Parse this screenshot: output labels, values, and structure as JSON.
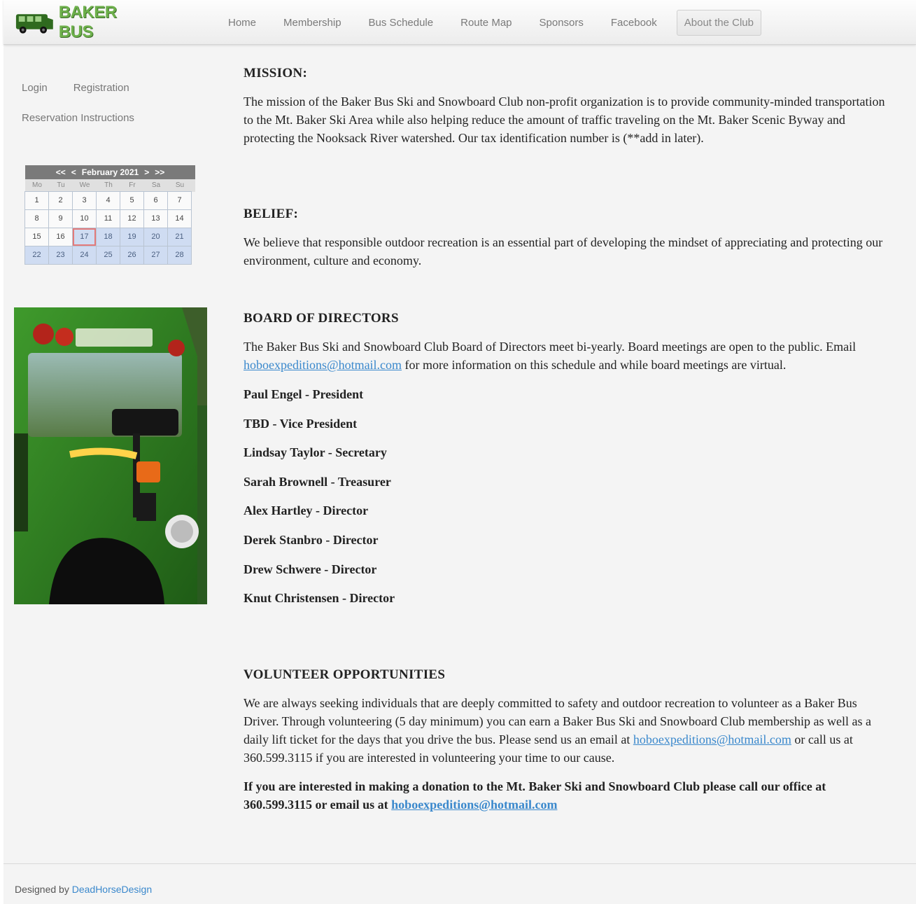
{
  "header": {
    "logo_text": "BAKER BUS",
    "nav": [
      "Home",
      "Membership",
      "Bus Schedule",
      "Route Map",
      "Sponsors",
      "Facebook",
      "About the Club"
    ],
    "active_nav": "About the Club"
  },
  "sidebar": {
    "login": "Login",
    "registration": "Registration",
    "reservation": "Reservation Instructions"
  },
  "calendar": {
    "prev_year": "<<",
    "prev_month": "<",
    "month_label": "February 2021",
    "next_month": ">",
    "next_year": ">>",
    "weekdays": [
      "Mo",
      "Tu",
      "We",
      "Th",
      "Fr",
      "Sa",
      "Su"
    ],
    "weeks": [
      [
        1,
        2,
        3,
        4,
        5,
        6,
        7
      ],
      [
        8,
        9,
        10,
        11,
        12,
        13,
        14
      ],
      [
        15,
        16,
        17,
        18,
        19,
        20,
        21
      ],
      [
        22,
        23,
        24,
        25,
        26,
        27,
        28
      ]
    ],
    "today": 17
  },
  "mission": {
    "heading": "MISSION:",
    "text": "The mission of the Baker Bus Ski and Snowboard Club non-profit organization is to provide community-minded transportation to the Mt. Baker Ski Area while also helping reduce the amount of traffic traveling on the Mt. Baker Scenic Byway and protecting the Nooksack River watershed. Our tax identification number is (**add in later)."
  },
  "belief": {
    "heading": "BELIEF:",
    "text": "We believe that responsible outdoor recreation is an essential part of developing the mindset of appreciating and protecting our environment, culture and economy."
  },
  "board": {
    "heading": "BOARD OF DIRECTORS",
    "text_before": "The Baker Bus Ski and Snowboard Club Board of Directors meet bi-yearly. Board meetings are open to the public. Email ",
    "email": "hoboexpeditions@hotmail.com",
    "text_after": " for more information on this schedule and while board meetings are virtual.",
    "members": [
      "Paul Engel - President",
      "TBD - Vice President",
      "Lindsay Taylor - Secretary",
      "Sarah Brownell - Treasurer",
      "Alex Hartley - Director",
      "Derek Stanbro - Director",
      "Drew Schwere - Director",
      "Knut Christensen - Director"
    ]
  },
  "volunteer": {
    "heading": "VOLUNTEER OPPORTUNITIES",
    "text_before": "We are always seeking individuals that are deeply committed to safety and outdoor recreation to volunteer as a Baker Bus Driver. Through volunteering (5 day minimum) you can earn a Baker Bus Ski and Snowboard Club membership as well as a daily lift ticket for the days that you drive the bus. Please send us an email at ",
    "email": "hoboexpeditions@hotmail.com",
    "text_after": " or call us at 360.599.3115 if you are interested in volunteering your time to our cause.",
    "donation_before": "If you are interested in making a donation to the Mt. Baker Ski and Snowboard Club please call our office at 360.599.3115 or email us at ",
    "donation_email": "hoboexpeditions@hotmail.com"
  },
  "footer": {
    "designed_by": "Designed by ",
    "designer": "DeadHorseDesign"
  },
  "colors": {
    "brand_green": "#6db04b",
    "link_blue": "#3a88cc"
  }
}
